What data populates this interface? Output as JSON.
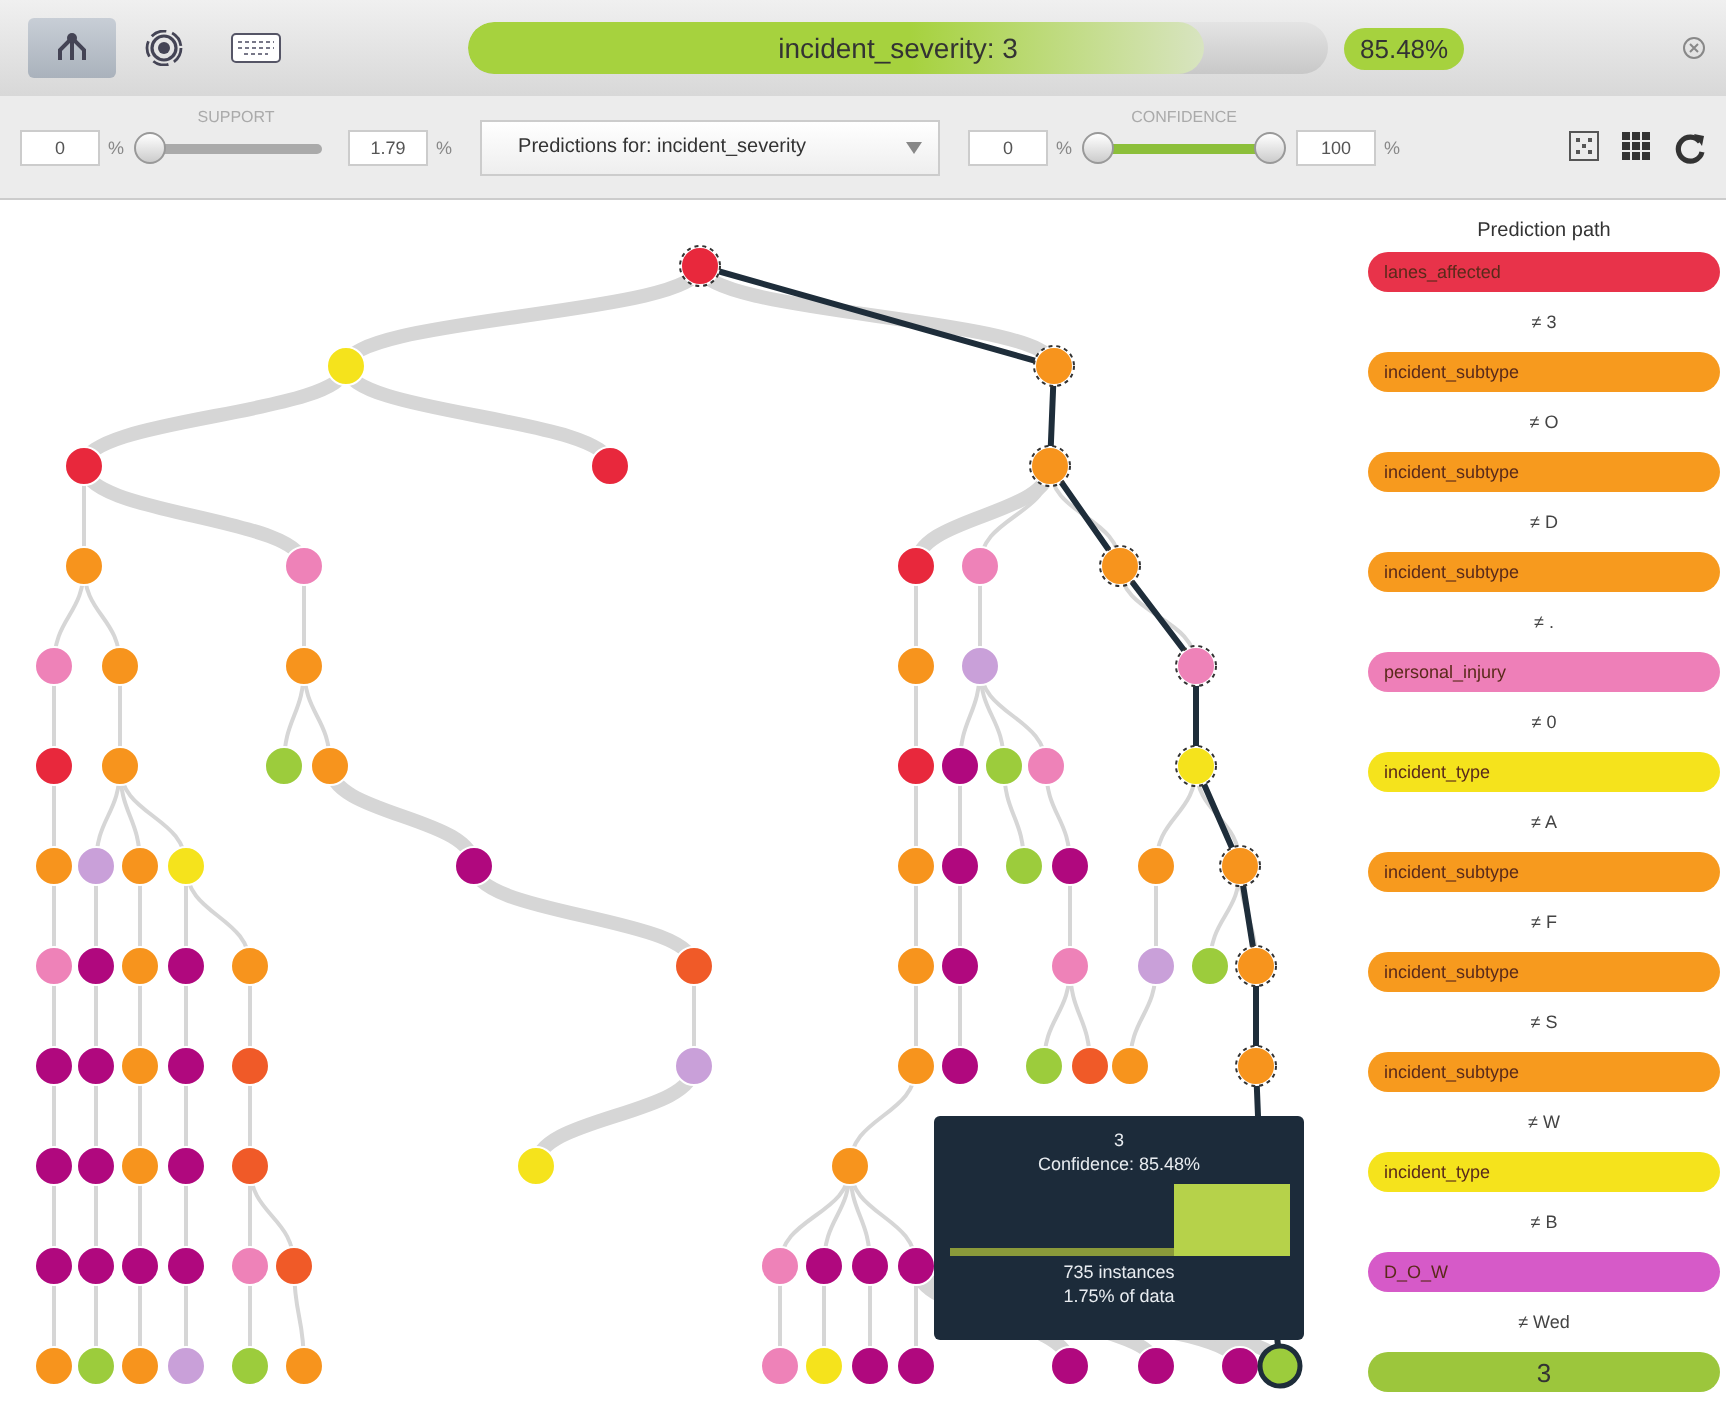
{
  "toolbar": {
    "view_tabs": [
      {
        "kind": "tree",
        "selected": true
      },
      {
        "kind": "sunburst",
        "selected": false
      },
      {
        "kind": "keyboard",
        "selected": false
      }
    ],
    "prediction": {
      "label": "incident_severity: 3",
      "level": 0.8548,
      "confidence": "85.48%"
    }
  },
  "filters": {
    "support": {
      "label": "SUPPORT",
      "min": "0",
      "max": "1.79",
      "unit": "%",
      "level": 0
    },
    "dropdown": "Predictions for: incident_severity",
    "confidence": {
      "label": "CONFIDENCE",
      "min": "0",
      "max": "100",
      "unit": "%",
      "level": 1
    }
  },
  "tooltip": {
    "title": "3",
    "confidence": "Confidence: 85.48%",
    "instances": "735 instances",
    "share": "1.75% of data"
  },
  "path": {
    "title": "Prediction path",
    "steps": [
      {
        "kind": "field",
        "label": "lanes_affected",
        "color": "#e8334a"
      },
      {
        "kind": "condition",
        "label": "≠ 3"
      },
      {
        "kind": "field",
        "label": "incident_subtype",
        "color": "#f79a1e"
      },
      {
        "kind": "condition",
        "label": "≠ O"
      },
      {
        "kind": "field",
        "label": "incident_subtype",
        "color": "#f79a1e"
      },
      {
        "kind": "condition",
        "label": "≠ D"
      },
      {
        "kind": "field",
        "label": "incident_subtype",
        "color": "#f79a1e"
      },
      {
        "kind": "condition",
        "label": "≠ ."
      },
      {
        "kind": "field",
        "label": "personal_injury",
        "color": "#ee7fb8"
      },
      {
        "kind": "condition",
        "label": "≠ 0"
      },
      {
        "kind": "field",
        "label": "incident_type",
        "color": "#f5e31c"
      },
      {
        "kind": "condition",
        "label": "≠ A"
      },
      {
        "kind": "field",
        "label": "incident_subtype",
        "color": "#f79a1e"
      },
      {
        "kind": "condition",
        "label": "≠ F"
      },
      {
        "kind": "field",
        "label": "incident_subtype",
        "color": "#f79a1e"
      },
      {
        "kind": "condition",
        "label": "≠ S"
      },
      {
        "kind": "field",
        "label": "incident_subtype",
        "color": "#f79a1e"
      },
      {
        "kind": "condition",
        "label": "≠ W"
      },
      {
        "kind": "field",
        "label": "incident_type",
        "color": "#f5e31c"
      },
      {
        "kind": "condition",
        "label": "≠ B"
      },
      {
        "kind": "field",
        "label": "D_O_W",
        "color": "#d65ac8"
      },
      {
        "kind": "condition",
        "label": "≠ Wed"
      },
      {
        "kind": "result",
        "label": "3",
        "color": "#9cc63c"
      }
    ]
  }
}
